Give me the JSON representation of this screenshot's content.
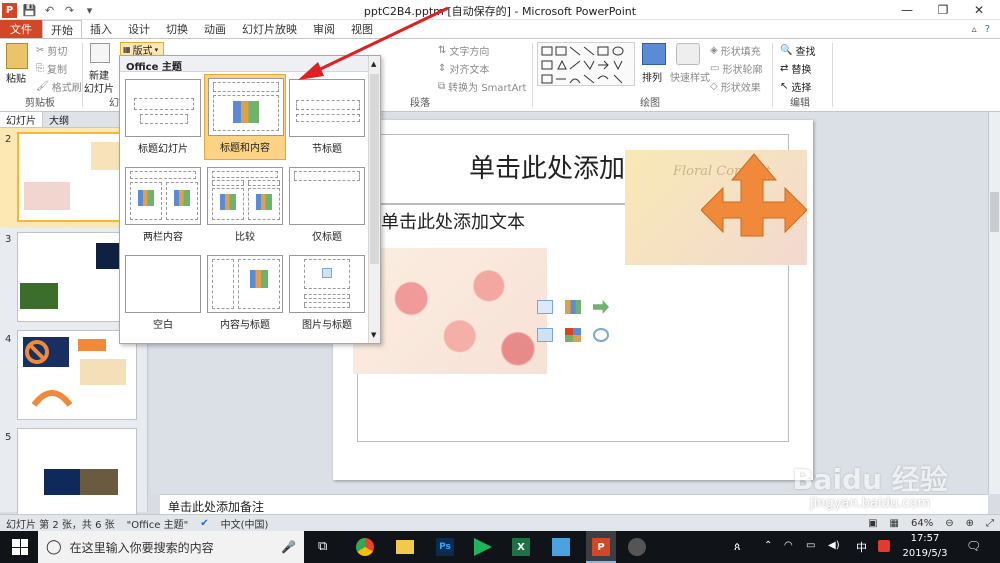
{
  "window": {
    "title": "pptC2B4.pptm [自动保存的] - Microsoft PowerPoint",
    "controls": [
      "—",
      "❐",
      "✕"
    ]
  },
  "tabs": [
    "文件",
    "开始",
    "插入",
    "设计",
    "切换",
    "动画",
    "幻灯片放映",
    "审阅",
    "视图"
  ],
  "ribbon": {
    "paste": "粘贴",
    "cut": "剪切",
    "copy": "复制",
    "format_painter": "格式刷",
    "clipboard_group": "剪贴板",
    "new_slide": "新建",
    "new_slide2": "幻灯片",
    "slides_group_short": "幻",
    "layout_btn": "版式",
    "text_direction": "文字方向",
    "align_text": "对齐文本",
    "smartart": "转换为 SmartArt",
    "paragraph_group": "段落",
    "arrange": "排列",
    "quick_styles": "快速样式",
    "shape_fill": "形状填充",
    "shape_outline": "形状轮廓",
    "shape_effects": "形状效果",
    "drawing_group": "绘图",
    "find": "查找",
    "replace": "替换",
    "select": "选择",
    "editing_group": "编辑"
  },
  "layout_menu": {
    "header": "Office 主题",
    "items": [
      "标题幻灯片",
      "标题和内容",
      "节标题",
      "两栏内容",
      "比较",
      "仅标题",
      "空白",
      "内容与标题",
      "图片与标题"
    ],
    "selected": "标题和内容"
  },
  "left_pane": {
    "tabs": [
      "幻灯片",
      "大纲"
    ],
    "slide_numbers": [
      "2",
      "3",
      "4",
      "5"
    ]
  },
  "slide": {
    "title": "单击此处添加标题",
    "body": "单击此处添加文本",
    "deco_text": "Floral Concept"
  },
  "notes": "单击此处添加备注",
  "status": {
    "slide_info": "幻灯片 第 2 张，共 6 张",
    "theme": "\"Office 主题\"",
    "language": "中文(中国)",
    "zoom": "64%"
  },
  "taskbar": {
    "search_placeholder": "在这里输入你要搜索的内容",
    "time": "17:57",
    "date": "2019/5/3",
    "ime": "中"
  },
  "watermark": {
    "brand": "Baidu 经验",
    "url": "jingyan.baidu.com"
  },
  "colors": {
    "accent": "#d24726",
    "arrow": "#e02020",
    "selected_layout": "#fcd385",
    "orange_shape": "#f08a3a"
  }
}
